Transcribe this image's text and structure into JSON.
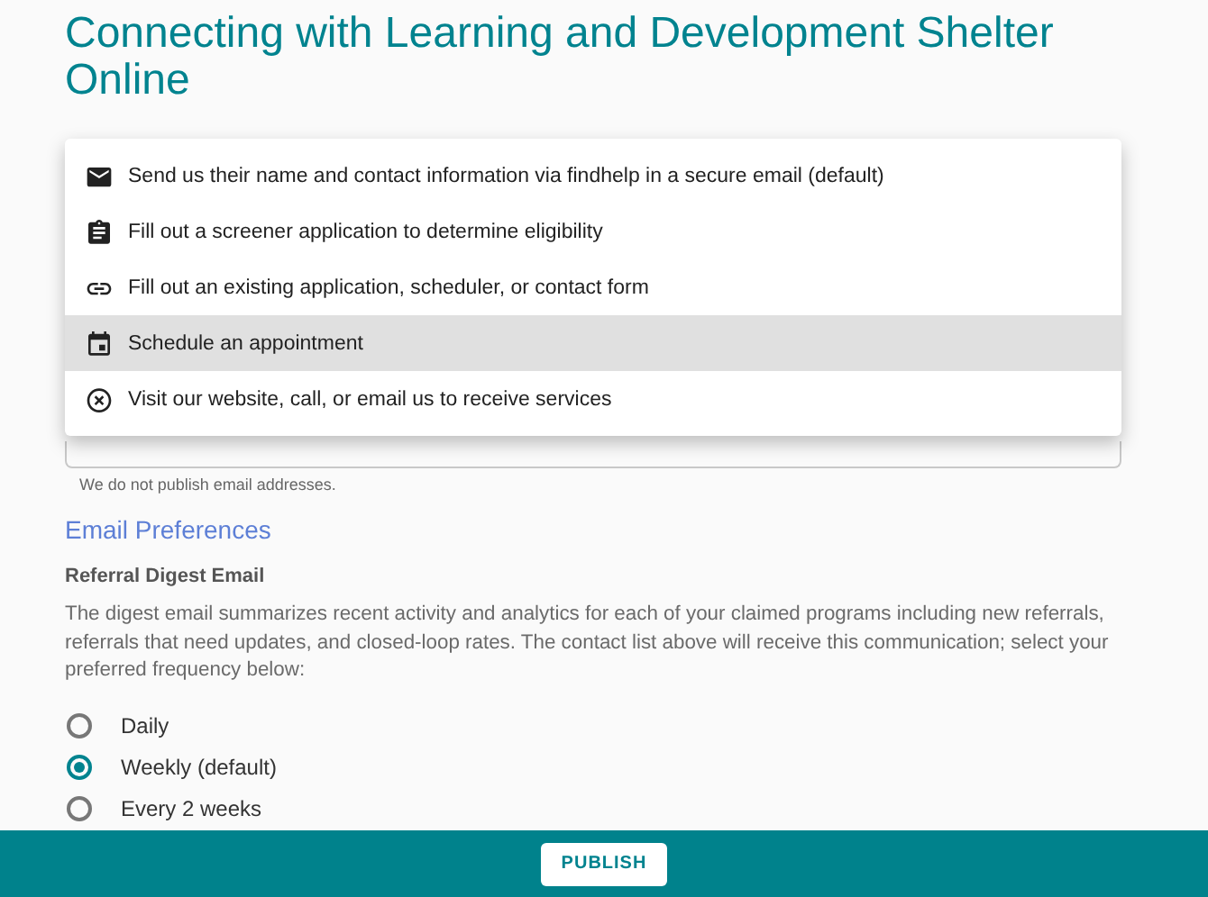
{
  "page": {
    "title": "Connecting with Learning and Development Shelter Online"
  },
  "menu": {
    "items": [
      {
        "kind": "mail",
        "label": "Send us their name and contact information via findhelp in a secure email (default)",
        "selected": false
      },
      {
        "kind": "clipboard",
        "label": "Fill out a screener application to determine eligibility",
        "selected": false
      },
      {
        "kind": "link",
        "label": "Fill out an existing application, scheduler, or contact form",
        "selected": false
      },
      {
        "kind": "calendar",
        "label": "Schedule an appointment",
        "selected": true
      },
      {
        "kind": "cancel",
        "label": "Visit our website, call, or email us to receive services",
        "selected": false
      }
    ]
  },
  "email_field": {
    "helper": "We do not publish email addresses."
  },
  "preferences": {
    "heading": "Email Preferences",
    "subheading": "Referral Digest Email",
    "description": "The digest email summarizes recent activity and analytics for each of your claimed programs including new referrals, referrals that need updates, and closed-loop rates. The contact list above will receive this communication; select your preferred frequency below:",
    "options": [
      {
        "label": "Daily",
        "selected": false
      },
      {
        "label": "Weekly (default)",
        "selected": true
      },
      {
        "label": "Every 2 weeks",
        "selected": false
      }
    ]
  },
  "footer": {
    "button": "PUBLISH"
  }
}
